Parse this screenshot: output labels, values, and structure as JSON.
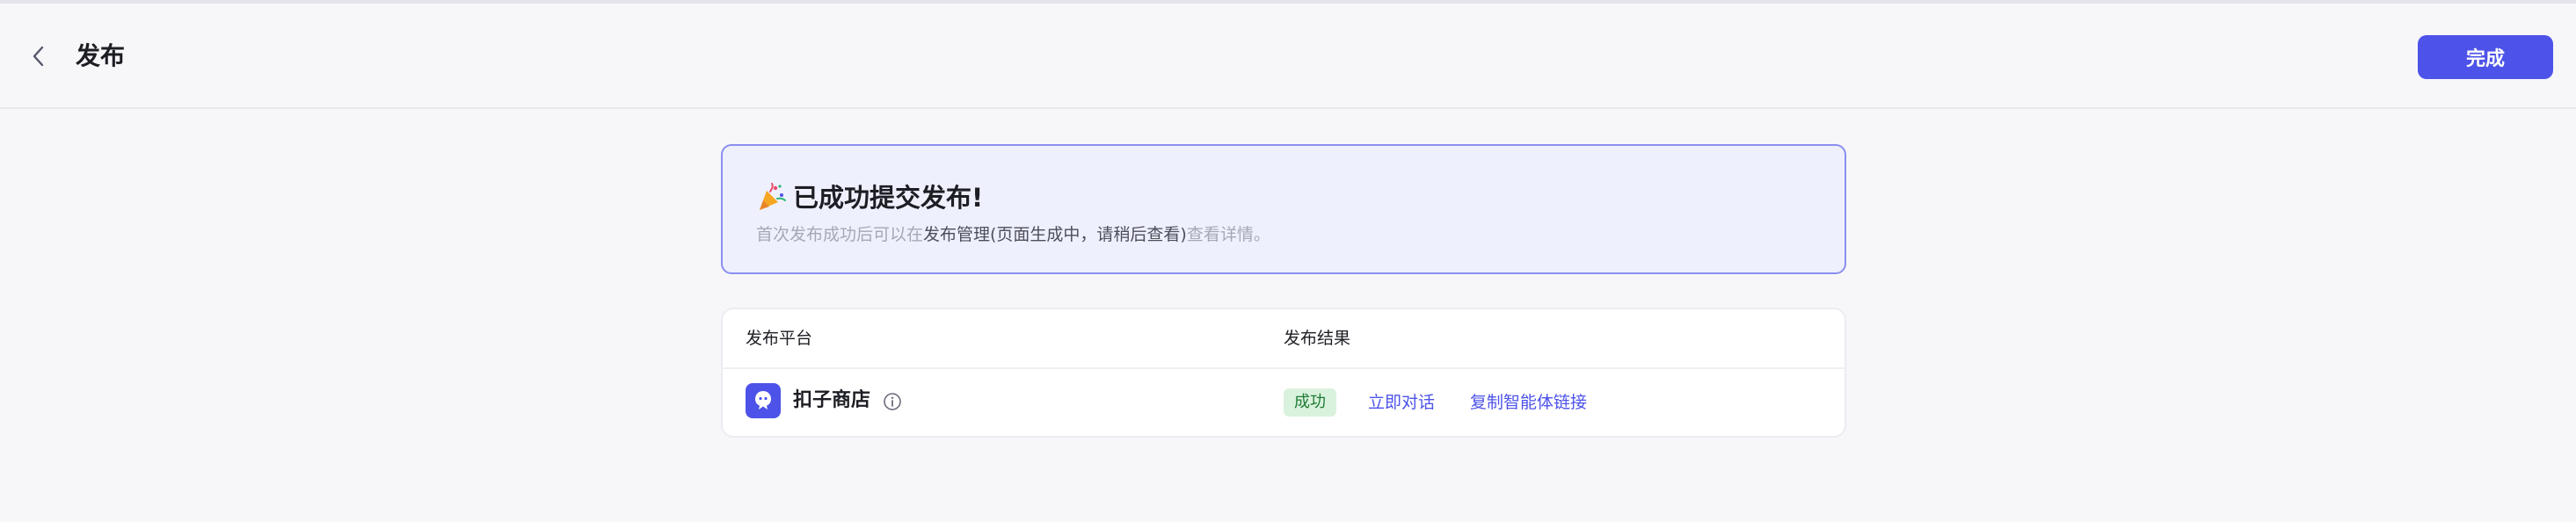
{
  "header": {
    "title": "发布",
    "done_label": "完成"
  },
  "banner": {
    "title": "已成功提交发布!",
    "desc_prefix": "首次发布成功后可以在",
    "desc_link": "发布管理(页面生成中，请稍后查看)",
    "desc_suffix": "查看详情。"
  },
  "table": {
    "columns": [
      "发布平台",
      "发布结果"
    ],
    "rows": [
      {
        "platform": "扣子商店",
        "status": "成功",
        "actions": [
          "立即对话",
          "复制智能体链接"
        ]
      }
    ]
  },
  "colors": {
    "accent": "#4d53e8",
    "success_bg": "#d9f2dd",
    "success_text": "#1f7a33",
    "banner_bg": "#eff0fd",
    "banner_border": "#8a8ff0"
  },
  "icons": {
    "back": "chevron-left-icon",
    "party": "party-popper-icon",
    "platform": "coze-store-logo-icon",
    "info": "info-icon"
  }
}
